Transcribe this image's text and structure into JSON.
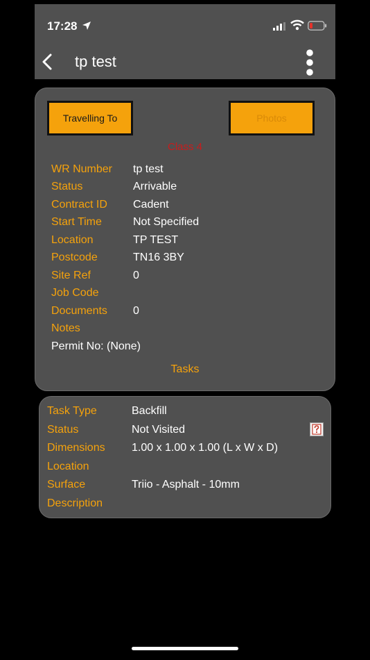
{
  "status_bar": {
    "time": "17:28",
    "icons": [
      "location-arrow-icon",
      "signal-icon",
      "wifi-icon",
      "battery-icon"
    ]
  },
  "nav": {
    "title": "tp test",
    "back_icon": "chevron-left-icon",
    "menu_icon": "more-vertical-icon"
  },
  "colors": {
    "accent": "#f5a20c",
    "class_label": "#c81c1c",
    "card_bg": "#505050",
    "screen_bg": "#000000"
  },
  "job": {
    "travelling_button": "Travelling To",
    "photos_button": "Photos",
    "class_label": "Class 4",
    "fields": [
      {
        "label": "WR Number",
        "value": "tp test"
      },
      {
        "label": "Status",
        "value": "Arrivable"
      },
      {
        "label": "Contract ID",
        "value": "Cadent"
      },
      {
        "label": "Start Time",
        "value": "Not Specified"
      },
      {
        "label": "Location",
        "value": "TP TEST"
      },
      {
        "label": "Postcode",
        "value": "TN16 3BY"
      },
      {
        "label": "Site Ref",
        "value": "0"
      },
      {
        "label": "Job Code",
        "value": ""
      },
      {
        "label": "Documents",
        "value": "0"
      },
      {
        "label": "Notes",
        "value": ""
      }
    ],
    "permit": "Permit No: (None)",
    "tasks_link": "Tasks"
  },
  "task": {
    "fields": [
      {
        "label": "Task Type",
        "value": "Backfill"
      },
      {
        "label": "Status",
        "value": "Not Visited"
      },
      {
        "label": "Dimensions",
        "value": "1.00 x 1.00 x 1.00 (L x W x D)"
      },
      {
        "label": "Location",
        "value": ""
      },
      {
        "label": "Surface",
        "value": "Triio - Asphalt - 10mm"
      },
      {
        "label": "Description",
        "value": ""
      }
    ],
    "status_icon": "help-icon"
  }
}
